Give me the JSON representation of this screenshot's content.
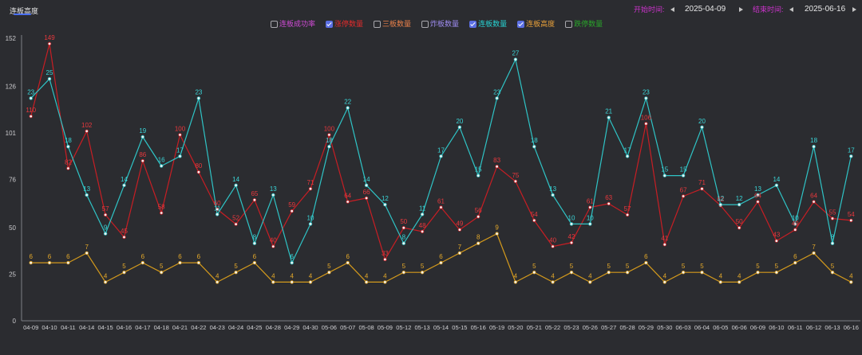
{
  "header": {
    "tab_label": "连板高度",
    "start_label": "开始时间:",
    "start_date": "2025-04-09",
    "end_label": "结束时间:",
    "end_date": "2025-06-16"
  },
  "chart_data": {
    "type": "line",
    "grid": false,
    "legend_position": "top",
    "legend": [
      {
        "name": "连板成功率",
        "checked": false,
        "color": "#d04bd6"
      },
      {
        "name": "涨停数量",
        "checked": true,
        "color": "#e32b2b"
      },
      {
        "name": "三板数量",
        "checked": false,
        "color": "#e8804a"
      },
      {
        "name": "炸板数量",
        "checked": false,
        "color": "#9e8cf0"
      },
      {
        "name": "连板数量",
        "checked": true,
        "color": "#27d3d3"
      },
      {
        "name": "连板高度",
        "checked": true,
        "color": "#e9a13a"
      },
      {
        "name": "跌停数量",
        "checked": false,
        "color": "#2aa52a"
      }
    ],
    "x": [
      "04-09",
      "04-10",
      "04-11",
      "04-14",
      "04-15",
      "04-16",
      "04-17",
      "04-18",
      "04-21",
      "04-22",
      "04-23",
      "04-24",
      "04-25",
      "04-28",
      "04-29",
      "04-30",
      "05-06",
      "05-07",
      "05-08",
      "05-09",
      "05-12",
      "05-13",
      "05-14",
      "05-15",
      "05-16",
      "05-19",
      "05-20",
      "05-21",
      "05-22",
      "05-23",
      "05-26",
      "05-27",
      "05-28",
      "05-29",
      "05-30",
      "06-03",
      "06-04",
      "06-05",
      "06-06",
      "06-09",
      "06-10",
      "06-11",
      "06-12",
      "06-13",
      "06-16"
    ],
    "ylim": [
      0,
      152
    ],
    "yticks": [
      0,
      25,
      50,
      76,
      101,
      126,
      152
    ],
    "y2lim": [
      0,
      29.2
    ],
    "series": [
      {
        "name": "涨停数量",
        "y_axis": 0,
        "color": "#c81e24",
        "label_color": "#e8383d",
        "values": [
          110,
          149,
          82,
          102,
          57,
          45,
          86,
          58,
          100,
          80,
          60,
          52,
          65,
          40,
          59,
          71,
          100,
          64,
          66,
          33,
          50,
          48,
          61,
          49,
          56,
          83,
          75,
          54,
          40,
          42,
          61,
          63,
          57,
          106,
          41,
          67,
          71,
          62,
          50,
          64,
          43,
          49,
          64,
          55,
          54
        ]
      },
      {
        "name": "连板数量",
        "y_axis": 1,
        "color": "#2fc4c6",
        "label_color": "#3ad6d8",
        "values": [
          23,
          25,
          18,
          13,
          9,
          14,
          19,
          16,
          17,
          23,
          11,
          14,
          8,
          13,
          6,
          10,
          18,
          22,
          14,
          12,
          8,
          11,
          17,
          20,
          15,
          23,
          27,
          18,
          13,
          10,
          10,
          21,
          17,
          23,
          15,
          15,
          20,
          12,
          12,
          13,
          14,
          10,
          18,
          8,
          17
        ]
      },
      {
        "name": "连板高度",
        "y_axis": 1,
        "color": "#d49a1c",
        "label_color": "#e3a82a",
        "values": [
          6,
          6,
          6,
          7,
          4,
          5,
          6,
          5,
          6,
          6,
          4,
          5,
          6,
          4,
          4,
          4,
          5,
          6,
          4,
          4,
          5,
          5,
          6,
          7,
          8,
          9,
          4,
          5,
          4,
          5,
          4,
          5,
          5,
          6,
          4,
          5,
          5,
          4,
          4,
          5,
          5,
          6,
          7,
          5,
          4
        ]
      }
    ]
  }
}
